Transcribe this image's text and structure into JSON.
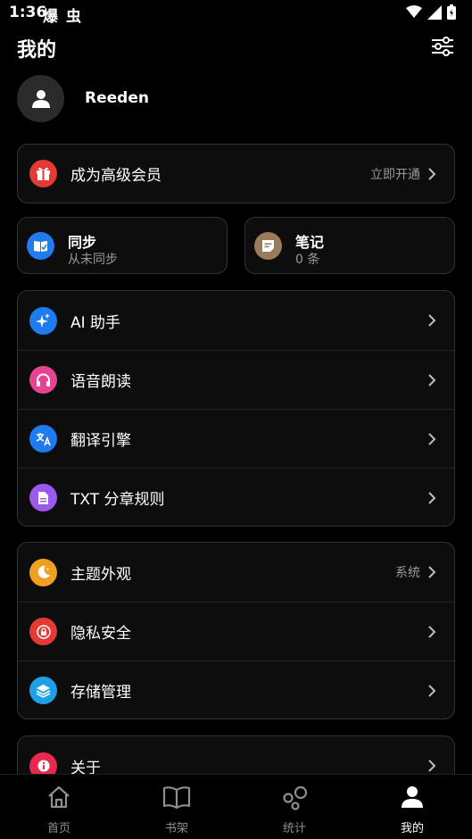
{
  "status_bar": {
    "time": "1:36",
    "notif_1": "爆",
    "notif_2": "虫"
  },
  "header": {
    "title": "我的"
  },
  "profile": {
    "name": "Reeden"
  },
  "premium": {
    "label": "成为高级会员",
    "action": "立即开通",
    "icon": "gift-icon",
    "color": "#e53935"
  },
  "sync": {
    "title": "同步",
    "subtitle": "从未同步",
    "icon": "book-sync-icon",
    "color": "#1e7bf0"
  },
  "notes": {
    "title": "笔记",
    "subtitle": "0 条",
    "icon": "note-icon",
    "color": "#9a7b5a"
  },
  "group1": [
    {
      "label": "AI 助手",
      "icon": "sparkle-icon",
      "color": "#1e7bf0"
    },
    {
      "label": "语音朗读",
      "icon": "headphones-icon",
      "color": "#e84393"
    },
    {
      "label": "翻译引擎",
      "icon": "translate-icon",
      "color": "#1e7bf0"
    },
    {
      "label": "TXT 分章规则",
      "icon": "document-icon",
      "color": "#9b59f0"
    }
  ],
  "group2": [
    {
      "label": "主题外观",
      "value": "系统",
      "icon": "moon-icon",
      "color": "#f0a020"
    },
    {
      "label": "隐私安全",
      "icon": "lock-icon",
      "color": "#e53935"
    },
    {
      "label": "存储管理",
      "icon": "layers-icon",
      "color": "#1ea0e8"
    }
  ],
  "group3": [
    {
      "label": "关于",
      "icon": "info-icon",
      "color": "#e8284d"
    }
  ],
  "nav": [
    {
      "label": "首页",
      "icon": "home-icon"
    },
    {
      "label": "书架",
      "icon": "book-icon"
    },
    {
      "label": "统计",
      "icon": "stats-icon"
    },
    {
      "label": "我的",
      "icon": "user-icon",
      "active": true
    }
  ]
}
